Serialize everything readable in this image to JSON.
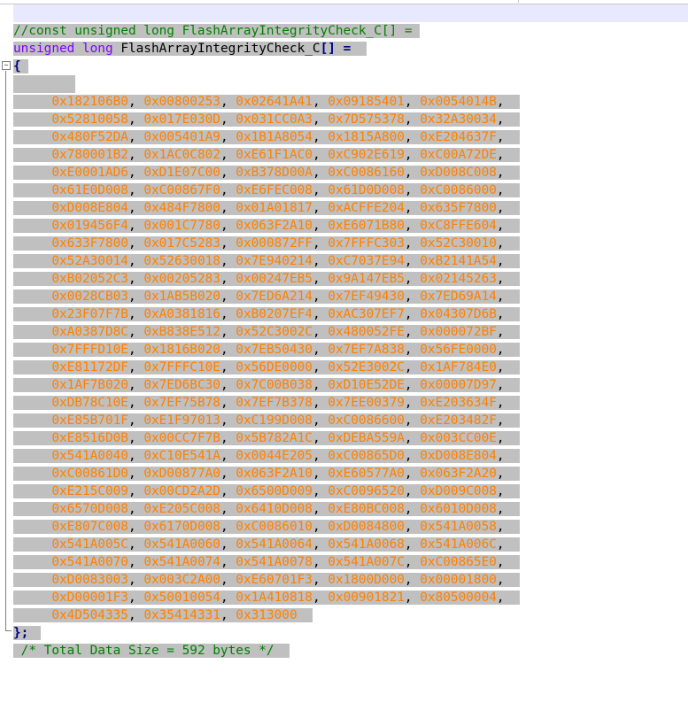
{
  "editor": {
    "comment_top": "//const unsigned long FlashArrayIntegrityCheck_C[] =",
    "decl_keyword1": "unsigned",
    "decl_keyword2": "long",
    "decl_name": "FlashArrayIntegrityCheck_C",
    "decl_brackets": "[]",
    "decl_eq": "=",
    "open_brace": "{",
    "close_brace": "};",
    "footer_comment": "/* Total Data Size = 592 bytes */",
    "fold_symbol": "−",
    "data_rows": [
      [
        "0x182106B0",
        "0x00800253",
        "0x02641A41",
        "0x09185401",
        "0x0054014B"
      ],
      [
        "0x52810058",
        "0x017E030D",
        "0x031CC0A3",
        "0x7D575378",
        "0x32A30034"
      ],
      [
        "0x480F52DA",
        "0x005401A9",
        "0x1B1A8054",
        "0x1815A800",
        "0xE204637F"
      ],
      [
        "0x780001B2",
        "0x1AC0C802",
        "0xE61F1AC0",
        "0xC902E619",
        "0xC00A72DE"
      ],
      [
        "0xE0001AD6",
        "0xD1E07C00",
        "0xB378D00A",
        "0xC0086160",
        "0xD008C008"
      ],
      [
        "0x61E0D008",
        "0xC00867F0",
        "0xE6FEC008",
        "0x61D0D008",
        "0xC0086000"
      ],
      [
        "0xD008E804",
        "0x484F7800",
        "0x01A01817",
        "0xACFFE204",
        "0x635F7800"
      ],
      [
        "0x019456F4",
        "0x001C7780",
        "0x063F2A10",
        "0xE6071B80",
        "0xC8FFE604"
      ],
      [
        "0x633F7800",
        "0x017C5283",
        "0x000872FF",
        "0x7FFFC303",
        "0x52C30010"
      ],
      [
        "0x52A30014",
        "0x52630018",
        "0x7E940214",
        "0xC7037E94",
        "0xB2141A54"
      ],
      [
        "0xB02052C3",
        "0x00205283",
        "0x00247EB5",
        "0x9A147EB5",
        "0x02145263"
      ],
      [
        "0x0028CB03",
        "0x1AB5B020",
        "0x7ED6A214",
        "0x7EF49430",
        "0x7ED69A14"
      ],
      [
        "0x23F07F7B",
        "0xA0381816",
        "0xB0207EF4",
        "0xAC307EF7",
        "0x04307D6B"
      ],
      [
        "0xA0387D8C",
        "0xB838E512",
        "0x52C3002C",
        "0x480052FE",
        "0x000072BF"
      ],
      [
        "0x7FFFD10E",
        "0x1816B020",
        "0x7EB50430",
        "0x7EF7A838",
        "0x56FE0000"
      ],
      [
        "0xE81172DF",
        "0x7FFFC10E",
        "0x56DE0000",
        "0x52E3002C",
        "0x1AF784E0"
      ],
      [
        "0x1AF7B020",
        "0x7ED6BC30",
        "0x7C00B038",
        "0xD10E52DE",
        "0x00007D97"
      ],
      [
        "0xDB78C10E",
        "0x7EF75B78",
        "0x7EF7B378",
        "0x7EE00379",
        "0xE203634F"
      ],
      [
        "0xE85B701F",
        "0xE1F97013",
        "0xC199D008",
        "0xC0086600",
        "0xE203482F"
      ],
      [
        "0xE8516D0B",
        "0x00CC7F7B",
        "0x5B782A1C",
        "0xDEBA559A",
        "0x003CC00E"
      ],
      [
        "0x541A0040",
        "0xC10E541A",
        "0x0044E205",
        "0xC00865D0",
        "0xD008E804"
      ],
      [
        "0xC00861D0",
        "0xD00877A0",
        "0x063F2A10",
        "0xE60577A0",
        "0x063F2A20"
      ],
      [
        "0xE215C009",
        "0x00CD2A2D",
        "0x6500D009",
        "0xC0096520",
        "0xD009C008"
      ],
      [
        "0x6570D008",
        "0xE205C008",
        "0x6410D008",
        "0xE80BC008",
        "0x6010D008"
      ],
      [
        "0xE807C008",
        "0x6170D008",
        "0xC0086010",
        "0xD0084800",
        "0x541A0058"
      ],
      [
        "0x541A005C",
        "0x541A0060",
        "0x541A0064",
        "0x541A0068",
        "0x541A006C"
      ],
      [
        "0x541A0070",
        "0x541A0074",
        "0x541A0078",
        "0x541A007C",
        "0xC00865E0"
      ],
      [
        "0xD0083003",
        "0x003C2A00",
        "0xE60701F3",
        "0x1800D000",
        "0x00001800"
      ],
      [
        "0xD00001F3",
        "0x50010054",
        "0x1A410818",
        "0x00901821",
        "0x80500004"
      ],
      [
        "0x4D504335",
        "0x35414331",
        "0x313000"
      ]
    ]
  }
}
